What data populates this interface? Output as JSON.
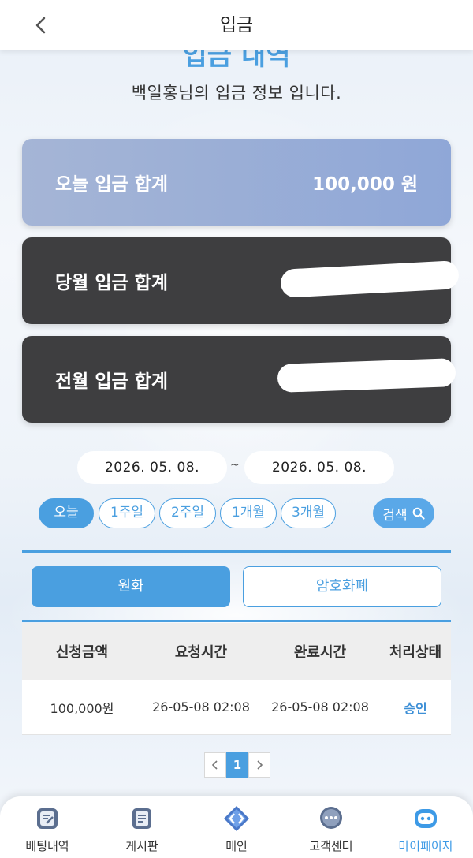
{
  "header": {
    "title": "입금"
  },
  "page": {
    "heading": "입금 내역",
    "subtitle": "백일홍님의 입금 정보 입니다."
  },
  "summary": {
    "today": {
      "label": "오늘 입금 합계",
      "value": "100,000 원"
    },
    "this_month": {
      "label": "당월 입금 합계",
      "value": ""
    },
    "prev_month": {
      "label": "전월 입금 합계",
      "value": ""
    }
  },
  "filter": {
    "start_date": "2026. 05. 08.",
    "separator": "~",
    "end_date": "2026. 05. 08.",
    "chips": [
      "오늘",
      "1주일",
      "2주일",
      "1개월",
      "3개월"
    ],
    "active_chip": "오늘",
    "search_label": "검색"
  },
  "tabs": {
    "krw": "원화",
    "crypto": "암호화폐",
    "active": "원화"
  },
  "table": {
    "headers": [
      "신청금액",
      "요청시간",
      "완료시간",
      "처리상태"
    ],
    "rows": [
      {
        "amount": "100,000원",
        "requested": "26-05-08 02:08",
        "completed": "26-05-08 02:08",
        "status": "승인"
      }
    ]
  },
  "pagination": {
    "current": "1",
    "prev_icon": "chevron-left-icon",
    "next_icon": "chevron-right-icon"
  },
  "bottom_nav": {
    "items": [
      {
        "label": "베팅내역",
        "icon": "note-edit-icon"
      },
      {
        "label": "게시판",
        "icon": "document-icon"
      },
      {
        "label": "메인",
        "icon": "diamond-arrows-icon"
      },
      {
        "label": "고객센터",
        "icon": "chat-bubble-icon"
      },
      {
        "label": "마이페이지",
        "icon": "robot-face-icon"
      }
    ],
    "active": "마이페이지"
  },
  "colors": {
    "accent": "#4a9fe0",
    "dark_card": "#3e3e40",
    "today_card": "#9aaed6",
    "status_approved": "#3d8fd6"
  }
}
